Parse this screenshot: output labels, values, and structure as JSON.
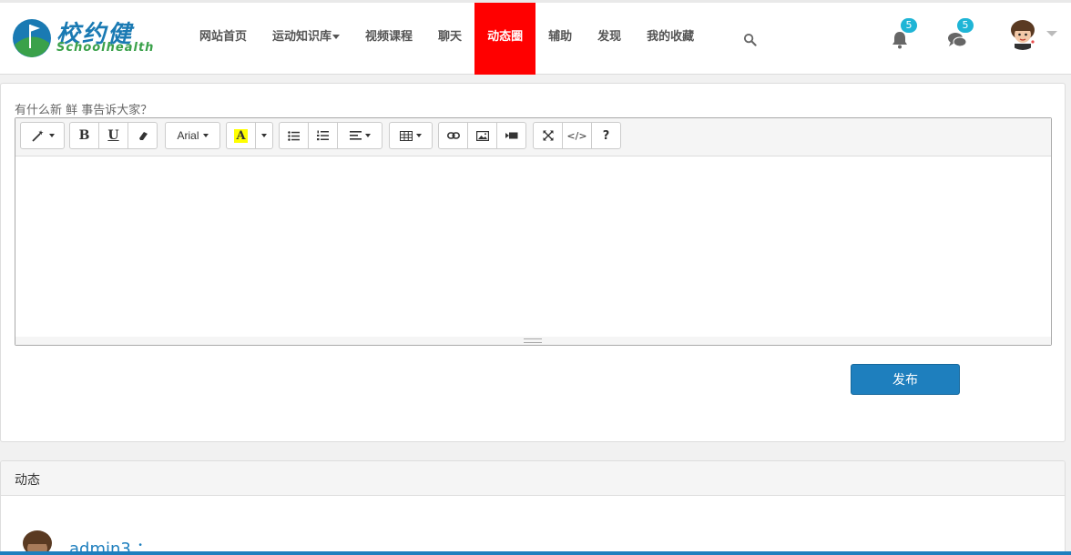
{
  "logo": {
    "name_cn": "校约健",
    "name_en": "Schoolhealth"
  },
  "nav": {
    "items": [
      {
        "label": "网站首页"
      },
      {
        "label": "运动知识库"
      },
      {
        "label": "视频课程"
      },
      {
        "label": "聊天"
      },
      {
        "label": "动态圈"
      },
      {
        "label": "辅助"
      },
      {
        "label": "发现"
      },
      {
        "label": "我的收藏"
      }
    ],
    "active_label": "动态圈",
    "active_color": "#ff0000"
  },
  "header": {
    "notifications": {
      "icon": "bell-icon",
      "count": "5"
    },
    "messages": {
      "icon": "comments-icon",
      "count": "5"
    },
    "badge_color": "#1fb5d6"
  },
  "post": {
    "prompt": "有什么新 鲜 事告诉大家？",
    "toolbar": {
      "bold": "B",
      "underline": "U",
      "font_name": "Arial",
      "highlight": "A",
      "code": "</>",
      "help": "?"
    },
    "publish_label": "发布",
    "publish_color": "#1e7fbe"
  },
  "feed": {
    "title": "动态",
    "items": [
      {
        "user": "admin3 ："
      }
    ]
  }
}
